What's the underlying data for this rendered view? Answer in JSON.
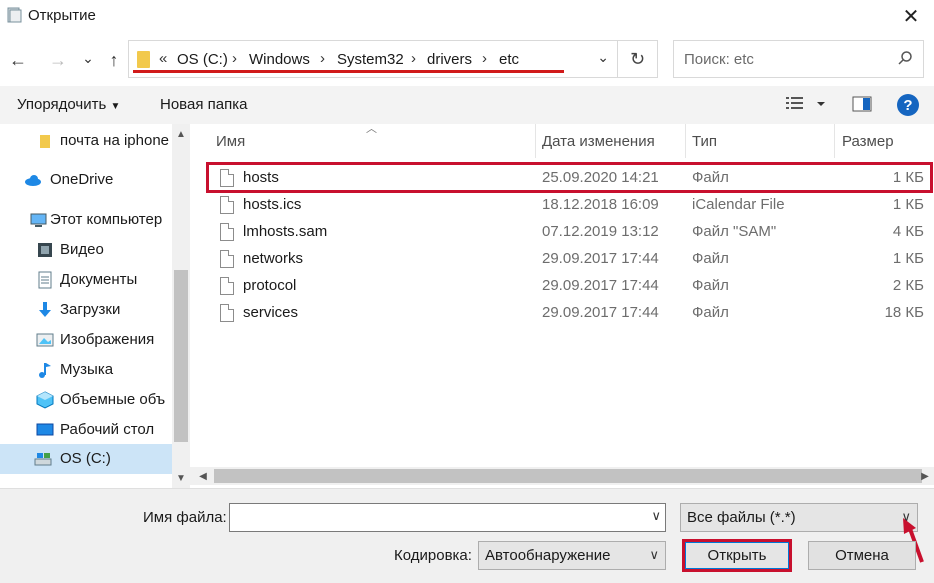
{
  "window": {
    "title": "Открытие",
    "close_glyph": "✕"
  },
  "nav": {
    "back_glyph": "←",
    "forward_glyph": "→",
    "recent_glyph": "⌄",
    "up_glyph": "↑",
    "refresh_glyph": "↻"
  },
  "address": {
    "overflow": "«",
    "crumbs": [
      "OS (C:)",
      "Windows",
      "System32",
      "drivers",
      "etc"
    ],
    "dropdown_glyph": "⌄"
  },
  "search": {
    "placeholder": "Поиск: etc"
  },
  "toolbar": {
    "organize_label": "Упорядочить",
    "new_folder_label": "Новая папка"
  },
  "sidebar": {
    "items": [
      {
        "label": "почта на iphone",
        "icon": "folder-icon"
      },
      {
        "label": "OneDrive",
        "icon": "onedrive-icon"
      },
      {
        "label": "Этот компьютер",
        "icon": "computer-icon"
      },
      {
        "label": "Видео",
        "icon": "video-icon"
      },
      {
        "label": "Документы",
        "icon": "documents-icon"
      },
      {
        "label": "Загрузки",
        "icon": "downloads-icon"
      },
      {
        "label": "Изображения",
        "icon": "pictures-icon"
      },
      {
        "label": "Музыка",
        "icon": "music-icon"
      },
      {
        "label": "Объемные объ",
        "icon": "3d-objects-icon"
      },
      {
        "label": "Рабочий стол",
        "icon": "desktop-icon"
      },
      {
        "label": "OS (C:)",
        "icon": "drive-icon"
      }
    ]
  },
  "columns": {
    "name": "Имя",
    "date": "Дата изменения",
    "type": "Тип",
    "size": "Размер"
  },
  "files": [
    {
      "name": "hosts",
      "date": "25.09.2020 14:21",
      "type": "Файл",
      "size": "1 КБ"
    },
    {
      "name": "hosts.ics",
      "date": "18.12.2018 16:09",
      "type": "iCalendar File",
      "size": "1 КБ"
    },
    {
      "name": "lmhosts.sam",
      "date": "07.12.2019 13:12",
      "type": "Файл \"SAM\"",
      "size": "4 КБ"
    },
    {
      "name": "networks",
      "date": "29.09.2017 17:44",
      "type": "Файл",
      "size": "1 КБ"
    },
    {
      "name": "protocol",
      "date": "29.09.2017 17:44",
      "type": "Файл",
      "size": "2 КБ"
    },
    {
      "name": "services",
      "date": "29.09.2017 17:44",
      "type": "Файл",
      "size": "18 КБ"
    }
  ],
  "bottom": {
    "filename_label": "Имя файла:",
    "filename_value": "",
    "filetype_value": "Все файлы  (*.*)",
    "encoding_label": "Кодировка:",
    "encoding_value": "Автообнаружение",
    "open_label": "Открыть",
    "cancel_label": "Отмена"
  },
  "colors": {
    "highlight_red": "#c8102e",
    "selection_blue": "#cce4f7",
    "help_blue": "#1565c0"
  }
}
